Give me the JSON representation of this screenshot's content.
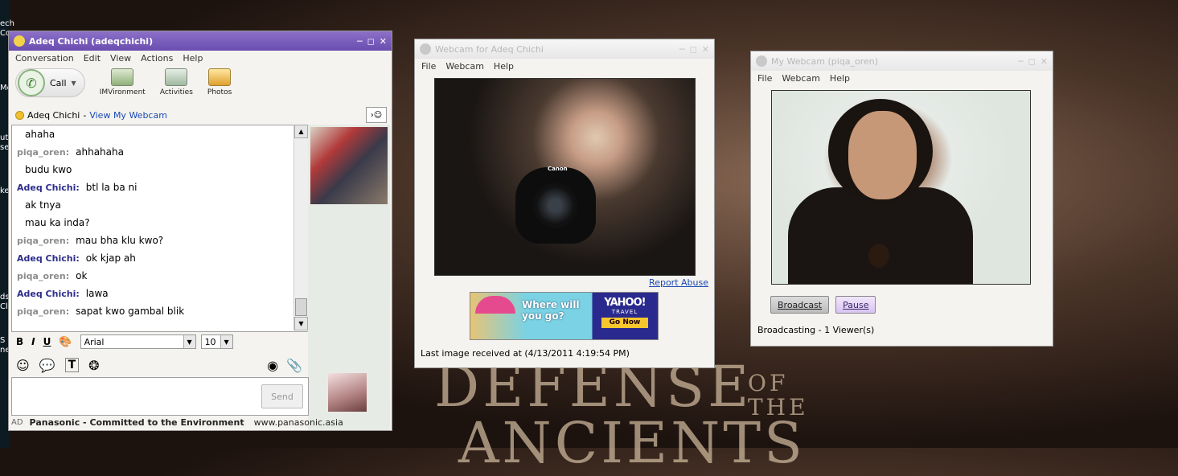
{
  "chat_window": {
    "title": "Adeq Chichi (adeqchichi)",
    "menu": [
      "Conversation",
      "Edit",
      "View",
      "Actions",
      "Help"
    ],
    "toolbar": {
      "call_label": "Call",
      "imvironment_label": "IMVironment",
      "activities_label": "Activities",
      "photos_label": "Photos"
    },
    "status_name": "Adeq Chichi",
    "status_sep": "-",
    "view_webcam_link": "View My Webcam",
    "messages": [
      {
        "sender": "",
        "text": "ahaha",
        "who": "cont"
      },
      {
        "sender": "piqa_oren:",
        "text": "ahhahaha",
        "who": "piqa"
      },
      {
        "sender": "",
        "text": "budu kwo",
        "who": "cont"
      },
      {
        "sender": "Adeq Chichi:",
        "text": "btl la ba ni",
        "who": "adeq"
      },
      {
        "sender": "",
        "text": "ak tnya",
        "who": "cont"
      },
      {
        "sender": "",
        "text": "mau ka inda?",
        "who": "cont"
      },
      {
        "sender": "piqa_oren:",
        "text": "mau bha klu kwo?",
        "who": "piqa"
      },
      {
        "sender": "Adeq Chichi:",
        "text": "ok kjap ah",
        "who": "adeq"
      },
      {
        "sender": "piqa_oren:",
        "text": "ok",
        "who": "piqa"
      },
      {
        "sender": "Adeq Chichi:",
        "text": "lawa",
        "who": "adeq"
      },
      {
        "sender": "piqa_oren:",
        "text": "sapat kwo gambal blik",
        "who": "piqa"
      }
    ],
    "format": {
      "bold": "B",
      "italic": "I",
      "underline": "U",
      "font_value": "Arial",
      "size_value": "10"
    },
    "send_label": "Send",
    "ad": {
      "tag": "AD",
      "text": "Panasonic - Committed to the Environment",
      "url": "www.panasonic.asia"
    }
  },
  "webcam_friend": {
    "title": "Webcam for Adeq Chichi",
    "menu": [
      "File",
      "Webcam",
      "Help"
    ],
    "report_abuse": "Report Abuse",
    "ad_text": "Where will you go?",
    "ad_brand": "YAHOO!",
    "ad_sub": "TRAVEL",
    "ad_cta": "Go Now",
    "camera_brand": "Canon",
    "last_image": "Last image received at (4/13/2011 4:19:54 PM)"
  },
  "webcam_mine": {
    "title": "My Webcam (piqa_oren)",
    "menu": [
      "File",
      "Webcam",
      "Help"
    ],
    "broadcast_label": "Broadcast",
    "pause_label": "Pause",
    "status": "Broadcasting - 1 Viewer(s)"
  },
  "desktop": {
    "icon_texts": [
      "ech",
      "Co",
      "Me",
      "ut",
      "se",
      "ke",
      "ds",
      "Cli",
      "S",
      "ne"
    ],
    "wallpaper": {
      "line1": "DEFENSE",
      "of": "OF",
      "the": "THE",
      "line2": "ANCIENTS"
    }
  },
  "colors": {
    "chat_title": "#7b5fc0",
    "link": "#1a49b5",
    "adeq_name": "#2d2d8c",
    "piqa_name": "#8c8c8c"
  }
}
